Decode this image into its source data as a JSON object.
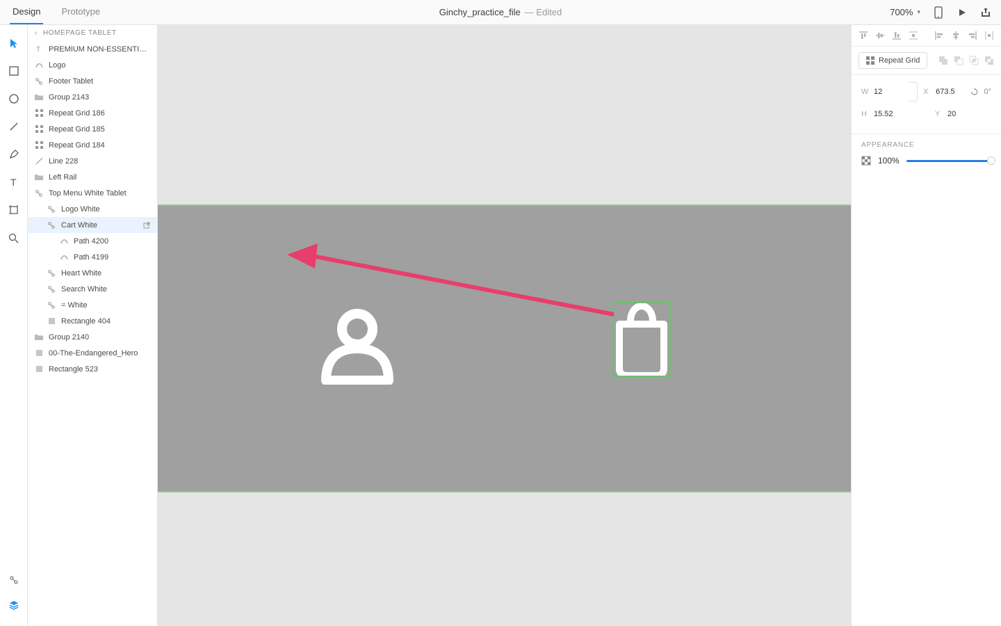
{
  "tabs": {
    "design": "Design",
    "prototype": "Prototype"
  },
  "doc": {
    "title": "Ginchy_practice_file",
    "status": "Edited"
  },
  "zoom": "700%",
  "layers": {
    "breadcrumb": "HOMEPAGE TABLET",
    "items": [
      {
        "icon": "text",
        "label": "PREMIUM  NON-ESSENTI…",
        "indent": 0
      },
      {
        "icon": "path",
        "label": "Logo",
        "indent": 0
      },
      {
        "icon": "link",
        "label": "Footer Tablet",
        "indent": 0
      },
      {
        "icon": "folder",
        "label": "Group 2143",
        "indent": 0
      },
      {
        "icon": "grid",
        "label": "Repeat Grid 186",
        "indent": 0
      },
      {
        "icon": "grid",
        "label": "Repeat Grid 185",
        "indent": 0
      },
      {
        "icon": "grid",
        "label": "Repeat Grid 184",
        "indent": 0
      },
      {
        "icon": "line",
        "label": "Line 228",
        "indent": 0
      },
      {
        "icon": "folder",
        "label": "Left Rail",
        "indent": 0
      },
      {
        "icon": "link",
        "label": "Top Menu White Tablet",
        "indent": 0
      },
      {
        "icon": "link",
        "label": "Logo White",
        "indent": 1
      },
      {
        "icon": "link",
        "label": "Cart White",
        "indent": 1,
        "selected": true,
        "popout": true
      },
      {
        "icon": "path",
        "label": "Path 4200",
        "indent": 2
      },
      {
        "icon": "path",
        "label": "Path 4199",
        "indent": 2
      },
      {
        "icon": "link",
        "label": "Heart White",
        "indent": 1
      },
      {
        "icon": "link",
        "label": "Search White",
        "indent": 1
      },
      {
        "icon": "link",
        "label": "= White",
        "indent": 1
      },
      {
        "icon": "rect",
        "label": "Rectangle 404",
        "indent": 1
      },
      {
        "icon": "folder",
        "label": "Group 2140",
        "indent": 0
      },
      {
        "icon": "rect",
        "label": "00-The-Endangered_Hero",
        "indent": 0
      },
      {
        "icon": "rect",
        "label": "Rectangle 523",
        "indent": 0
      }
    ]
  },
  "inspector": {
    "repeat_label": "Repeat Grid",
    "W": "12",
    "H": "15.52",
    "X": "673.5",
    "Y": "20",
    "rotation": "0°",
    "appearance_title": "APPEARANCE",
    "opacity": "100%"
  }
}
